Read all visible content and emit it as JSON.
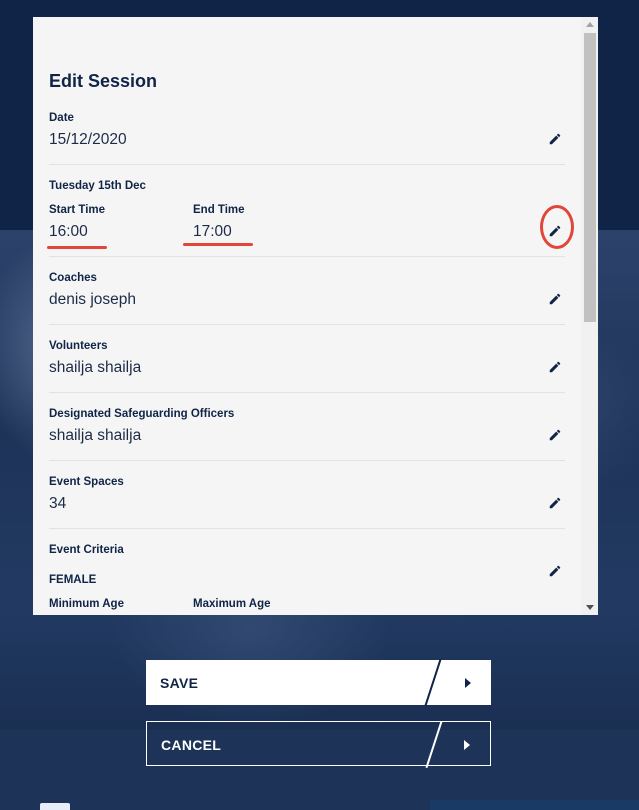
{
  "modal": {
    "title": "Edit Session",
    "fields": {
      "date": {
        "label": "Date",
        "value": "15/12/2020"
      },
      "time": {
        "day_label": "Tuesday 15th Dec",
        "start_label": "Start Time",
        "start_value": "16:00",
        "end_label": "End Time",
        "end_value": "17:00"
      },
      "coaches": {
        "label": "Coaches",
        "value": "denis joseph"
      },
      "volunteers": {
        "label": "Volunteers",
        "value": "shailja shailja"
      },
      "safeguarding": {
        "label": "Designated Safeguarding Officers",
        "value": "shailja shailja"
      },
      "spaces": {
        "label": "Event Spaces",
        "value": "34"
      },
      "criteria": {
        "label": "Event Criteria",
        "gender": "FEMALE",
        "min_age_label": "Minimum Age",
        "max_age_label": "Maximum Age"
      }
    }
  },
  "buttons": {
    "save": "SAVE",
    "cancel": "CANCEL"
  },
  "colors": {
    "navy": "#0f2447",
    "annotation": "#e0473a",
    "modal_bg": "#f5f5f5"
  },
  "icons": {
    "edit": "pencil-icon",
    "next": "play-arrow-icon"
  }
}
